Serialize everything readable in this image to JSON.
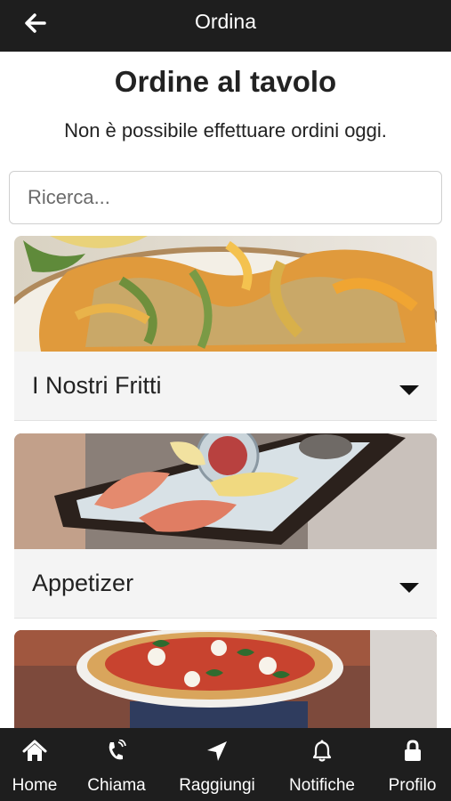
{
  "header": {
    "title": "Ordina",
    "back_icon": "arrow-left-icon"
  },
  "page": {
    "title": "Ordine al tavolo",
    "notice": "Non è possibile effettuare ordini oggi."
  },
  "search": {
    "placeholder": "Ricerca...",
    "value": ""
  },
  "categories": [
    {
      "label": "I Nostri Fritti",
      "image": "fried-vegetables-photo",
      "icon": "caret-down-icon"
    },
    {
      "label": "Appetizer",
      "image": "shrimp-platter-photo",
      "icon": "caret-down-icon"
    },
    {
      "label": "",
      "image": "pizza-photo"
    }
  ],
  "bottom_nav": [
    {
      "label": "Home",
      "icon": "home-icon"
    },
    {
      "label": "Chiama",
      "icon": "phone-icon"
    },
    {
      "label": "Raggiungi",
      "icon": "location-arrow-icon"
    },
    {
      "label": "Notifiche",
      "icon": "bell-icon"
    },
    {
      "label": "Profilo",
      "icon": "lock-icon"
    }
  ],
  "colors": {
    "bar": "#1e1e1e",
    "card_bar": "#f4f4f4",
    "text": "#222222"
  }
}
